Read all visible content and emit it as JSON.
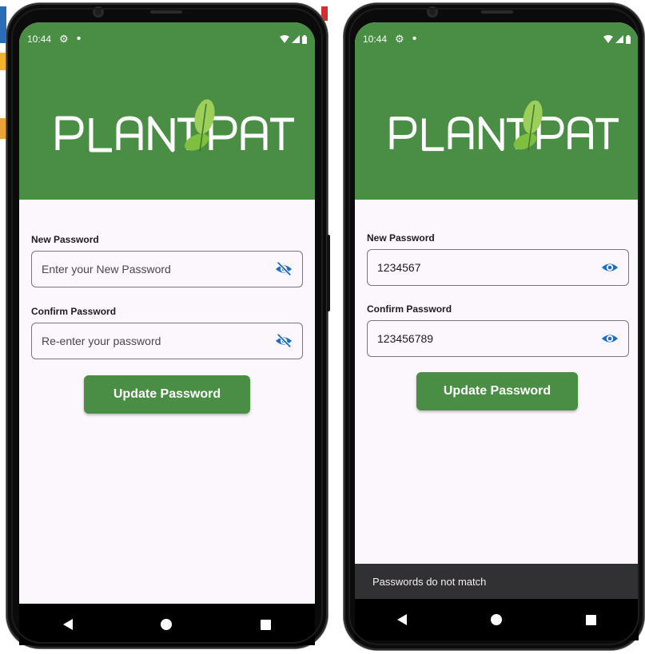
{
  "screens": [
    {
      "status": {
        "time": "10:44"
      },
      "logo_text": "PLANTPAT",
      "new_password": {
        "label": "New Password",
        "placeholder": "Enter your New Password",
        "value": "",
        "visibility_icon": "eye-off-icon"
      },
      "confirm_password": {
        "label": "Confirm Password",
        "placeholder": "Re-enter your password",
        "value": "",
        "visibility_icon": "eye-off-icon"
      },
      "update_button": "Update Password",
      "snackbar": ""
    },
    {
      "status": {
        "time": "10:44"
      },
      "logo_text": "PLANTPAT",
      "new_password": {
        "label": "New Password",
        "placeholder": "",
        "value": "1234567",
        "visibility_icon": "eye-icon"
      },
      "confirm_password": {
        "label": "Confirm Password",
        "placeholder": "",
        "value": "123456789",
        "visibility_icon": "eye-icon"
      },
      "update_button": "Update Password",
      "snackbar": "Passwords do not match"
    }
  ],
  "colors": {
    "primary_green": "#4a8e45",
    "icon_blue": "#1f6fbf",
    "screen_bg": "#fcf7fd",
    "snackbar_bg": "#313033"
  }
}
